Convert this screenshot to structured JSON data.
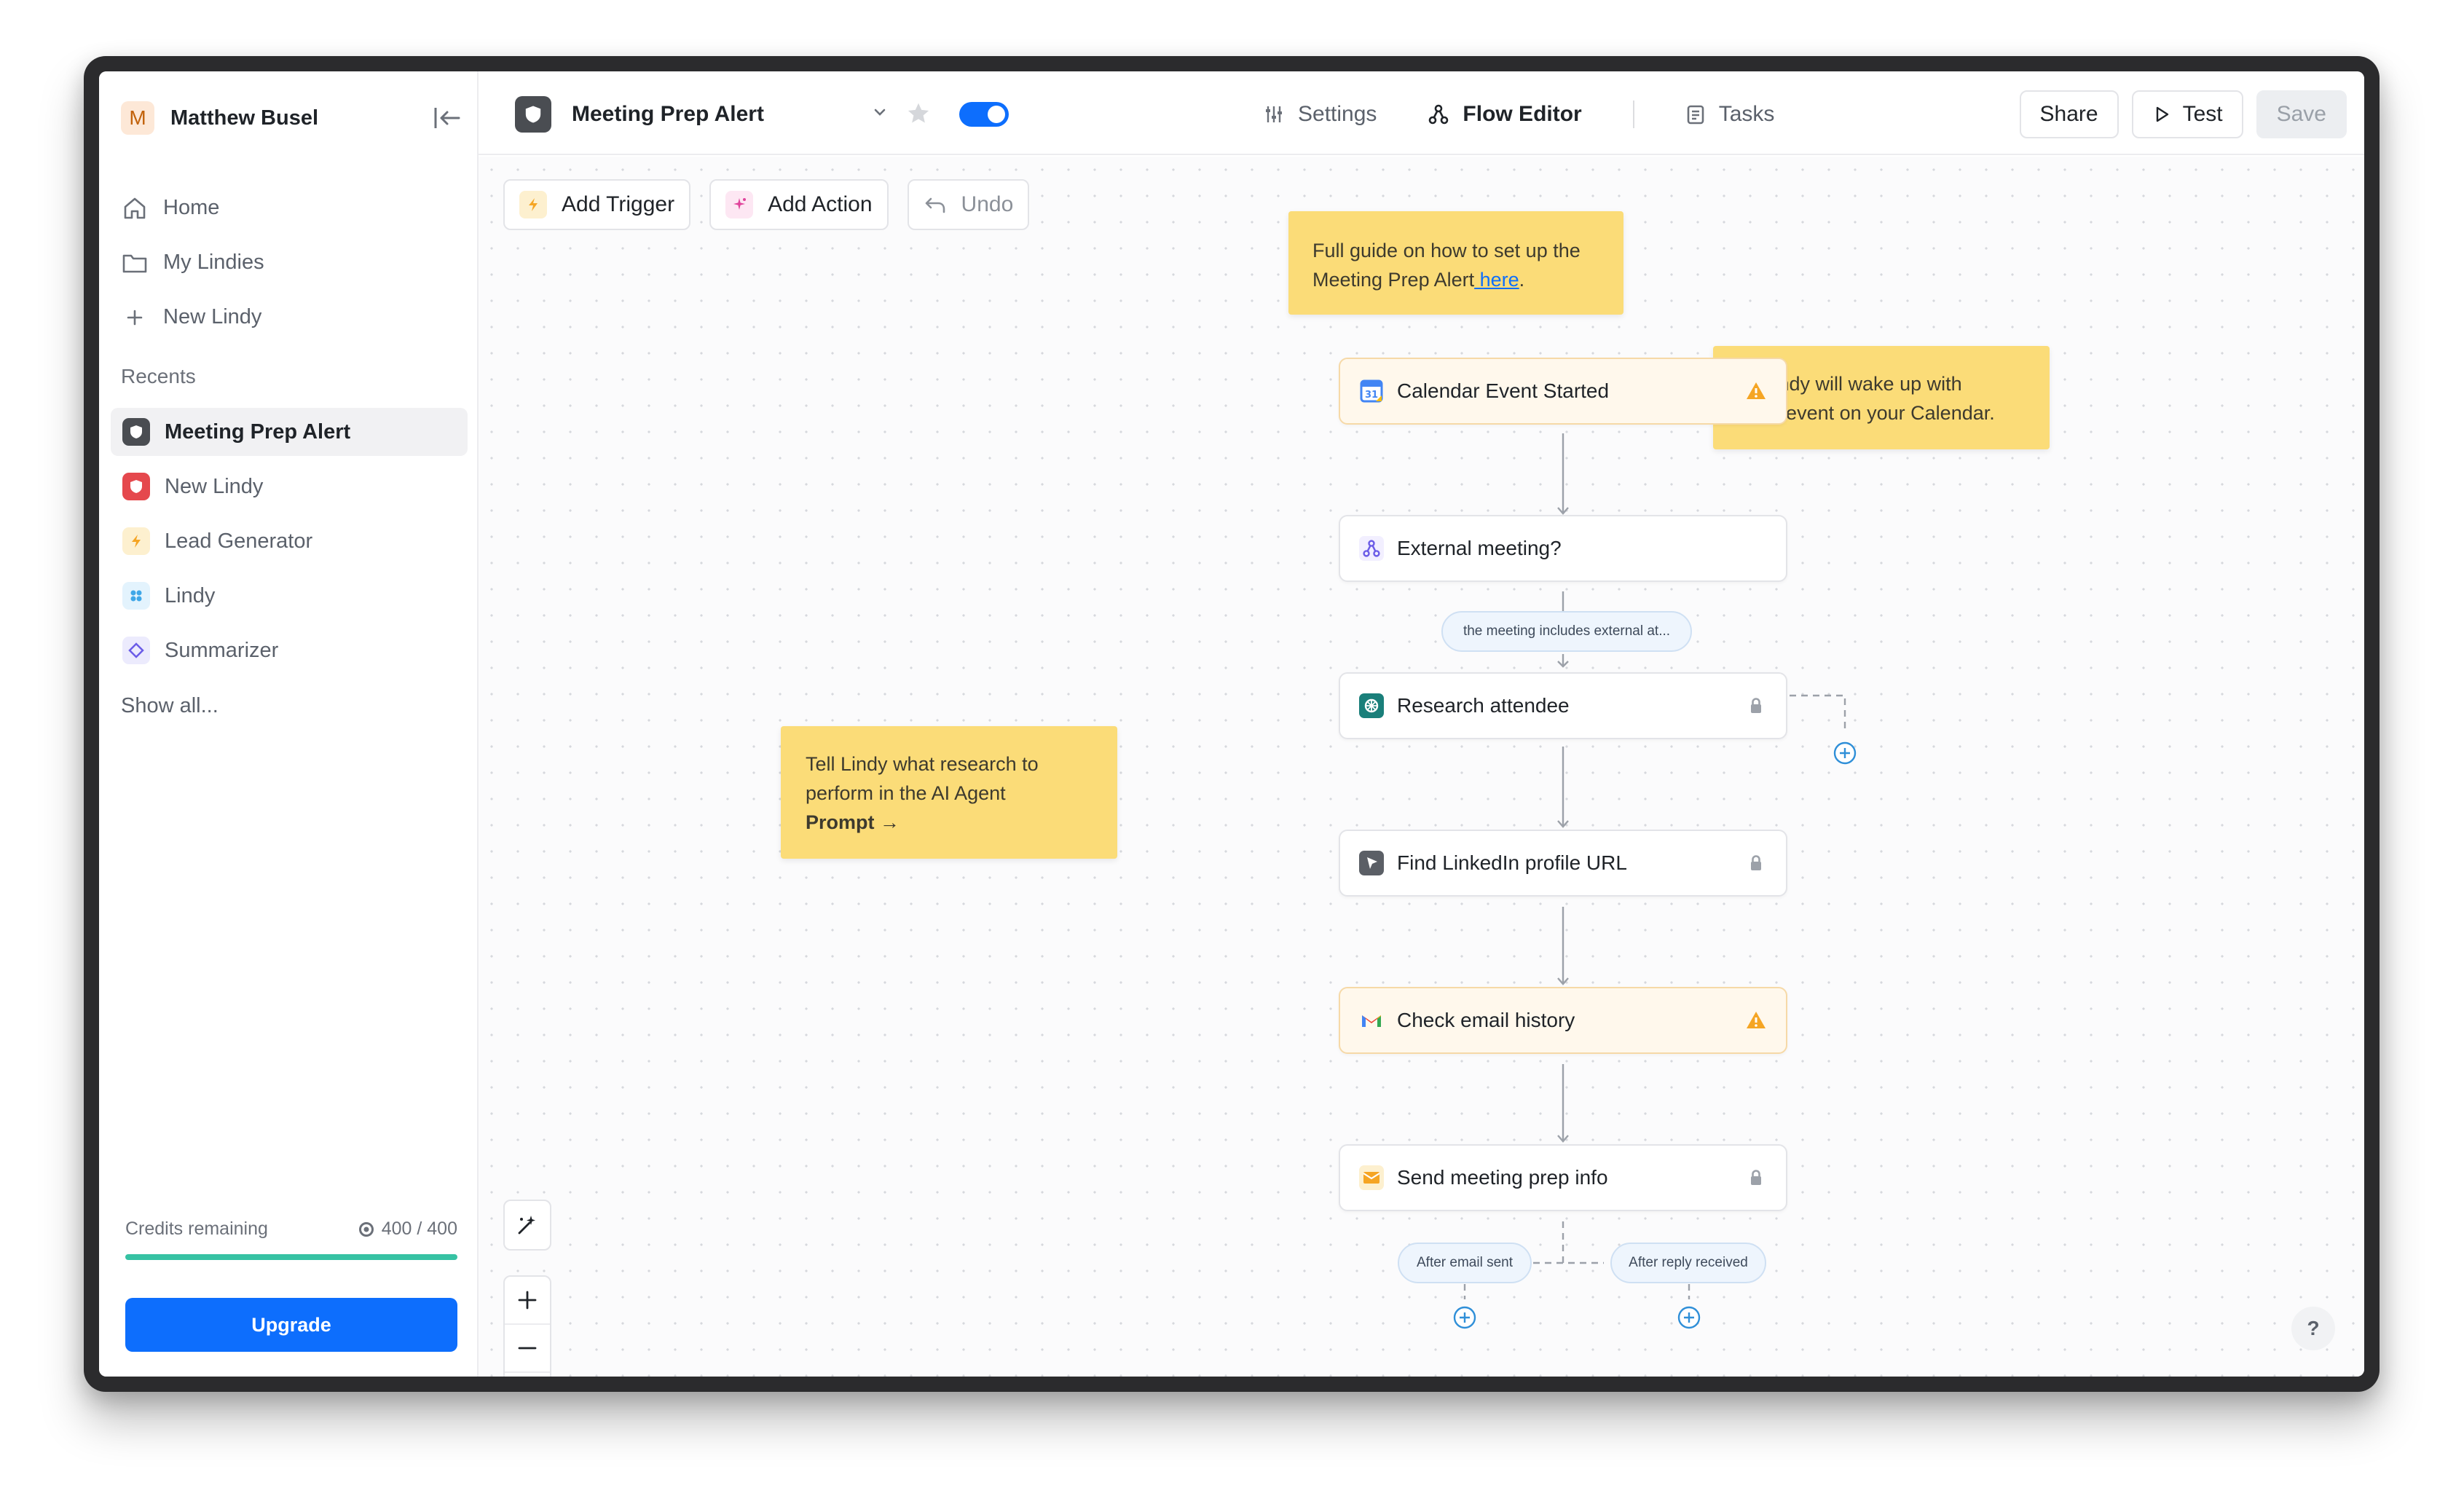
{
  "user": {
    "initial": "M",
    "name": "Matthew Busel"
  },
  "nav": {
    "home": "Home",
    "my_lindies": "My Lindies",
    "new_lindy": "New Lindy"
  },
  "recents": {
    "label": "Recents",
    "items": [
      {
        "label": "Meeting Prep Alert",
        "color": "#4a4d52"
      },
      {
        "label": "New Lindy",
        "color": "#e5484d"
      },
      {
        "label": "Lead Generator",
        "color": "#f5b83d"
      },
      {
        "label": "Lindy",
        "color": "#3fa7e8"
      },
      {
        "label": "Summarizer",
        "color": "#6b5ce7"
      }
    ],
    "show_all": "Show all..."
  },
  "credits": {
    "label": "Credits remaining",
    "value": "400 / 400",
    "fraction": 1.0
  },
  "upgrade_label": "Upgrade",
  "header": {
    "flow_name": "Meeting Prep Alert",
    "enabled": true,
    "tabs": [
      "Settings",
      "Flow Editor",
      "Tasks"
    ],
    "active_tab": "Flow Editor",
    "share_label": "Share",
    "test_label": "Test",
    "save_label": "Save"
  },
  "canvas_toolbar": {
    "add_trigger": "Add Trigger",
    "add_action": "Add Action",
    "undo": "Undo"
  },
  "notes": {
    "guide_text": "Full guide on how to set up the Meeting Prep Alert",
    "guide_link": " here",
    "guide_end": ".",
    "wake_line1": "← Lindy will wake up with",
    "wake_line2": "each event on your Calendar.",
    "research_line1": "Tell Lindy what research to",
    "research_line2": "perform in the AI Agent",
    "research_line3": "Prompt →"
  },
  "nodes": [
    {
      "label": "Calendar Event Started",
      "icon": "google-calendar-icon",
      "status": "warning"
    },
    {
      "label": "External meeting?",
      "icon": "condition-icon",
      "status": "none"
    },
    {
      "label": "Research attendee",
      "icon": "ai-agent-icon",
      "status": "locked"
    },
    {
      "label": "Find LinkedIn profile URL",
      "icon": "search-tool-icon",
      "status": "locked"
    },
    {
      "label": "Check email history",
      "icon": "gmail-icon",
      "status": "warning"
    },
    {
      "label": "Send meeting prep info",
      "icon": "mail-icon",
      "status": "locked"
    }
  ],
  "pills": {
    "condition": "the meeting includes external at...",
    "after_email_sent": "After email sent",
    "after_reply_received": "After reply received"
  },
  "help_label": "?"
}
